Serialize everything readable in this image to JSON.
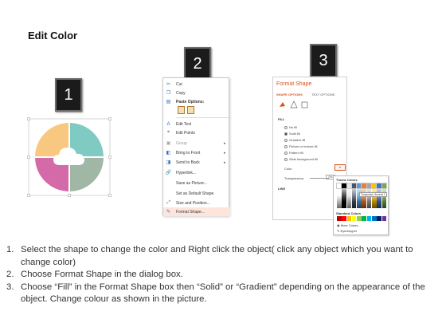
{
  "title": "Edit Color",
  "badges": [
    "1",
    "2",
    "3"
  ],
  "shape": {
    "colors": [
      "#f9c880",
      "#7fcbc3",
      "#d46aa8",
      "#9fb7a4"
    ],
    "icon": "cloud-icon"
  },
  "context_menu": {
    "items": [
      {
        "label": "Cut",
        "icon": "scissors-icon"
      },
      {
        "label": "Copy",
        "icon": "copy-icon"
      },
      {
        "label": "Paste Options:",
        "icon": "paste-icon"
      },
      {
        "label": "Edit Text",
        "icon": "edit-text-icon"
      },
      {
        "label": "Edit Points",
        "icon": "edit-points-icon"
      },
      {
        "label": "Group",
        "icon": "group-icon"
      },
      {
        "label": "Bring to Front",
        "icon": "bring-front-icon"
      },
      {
        "label": "Send to Back",
        "icon": "send-back-icon"
      },
      {
        "label": "Hyperlink...",
        "icon": "hyperlink-icon"
      },
      {
        "label": "Save as Picture...",
        "icon": ""
      },
      {
        "label": "Set as Default Shape",
        "icon": ""
      },
      {
        "label": "Size and Position...",
        "icon": "size-icon"
      },
      {
        "label": "Format Shape...",
        "icon": "format-shape-icon"
      }
    ],
    "highlight": "#fde5dc"
  },
  "format_panel": {
    "title": "Format Shape",
    "tabs": [
      "SHAPE OPTIONS",
      "TEXT OPTIONS"
    ],
    "fill_header": "FILL",
    "options": [
      "No fill",
      "Solid fill",
      "Gradient fill",
      "Picture or texture fill",
      "Pattern fill",
      "Slide background fill"
    ],
    "selected_option": "Solid fill",
    "color_label": "Color",
    "transparency_label": "Transparency",
    "transparency_value": "0%",
    "line_header": "LINE",
    "accent": "#d9541b"
  },
  "palette": {
    "theme_header": "Theme Colors",
    "standard_header": "Standard Colors",
    "tooltip": "Turquoise, Accent 1",
    "more_colors": "More Colors...",
    "eyedropper": "Eyedropper",
    "theme_colors": [
      "#ffffff",
      "#000000",
      "#e7e6e6",
      "#44546a",
      "#5b9bd5",
      "#ed7d31",
      "#a5a5a5",
      "#ffc000",
      "#4472c4",
      "#70ad47"
    ],
    "standard_colors": [
      "#c00000",
      "#ff0000",
      "#ffc000",
      "#ffff00",
      "#92d050",
      "#00b050",
      "#00b0f0",
      "#0070c0",
      "#002060",
      "#7030a0"
    ]
  },
  "instructions": [
    {
      "num": "1.",
      "text": "Select the shape to change the color and Right click the object( click any object which you want to change color)"
    },
    {
      "num": "2.",
      "text": "Choose Format Shape in the dialog box."
    },
    {
      "num": "3.",
      "text": "Choose “Fill” in the Format Shape box then “Solid” or “Gradient” depending on the appearance of the object. Change colour as shown in the picture."
    }
  ]
}
